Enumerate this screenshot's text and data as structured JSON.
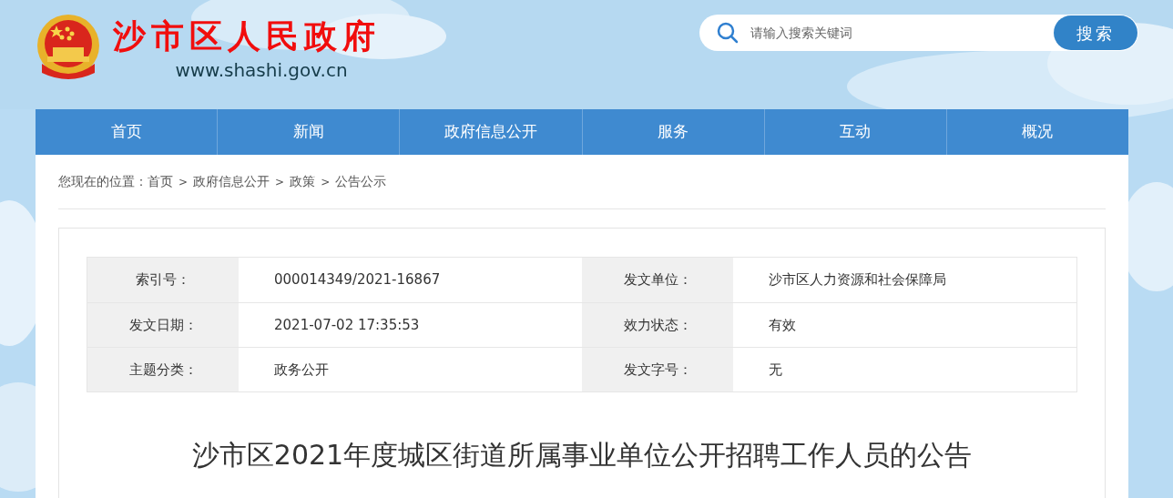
{
  "header": {
    "site_title": "沙市区人民政府",
    "site_url": "www.shashi.gov.cn"
  },
  "search": {
    "placeholder": "请输入搜索关键词",
    "button": "搜索"
  },
  "nav": [
    "首页",
    "新闻",
    "政府信息公开",
    "服务",
    "互动",
    "概况"
  ],
  "breadcrumb": [
    {
      "kind": "text",
      "text": "您现在的位置："
    },
    {
      "kind": "link",
      "text": "首页"
    },
    {
      "kind": "sep",
      "text": ">"
    },
    {
      "kind": "link",
      "text": "政府信息公开"
    },
    {
      "kind": "sep",
      "text": ">"
    },
    {
      "kind": "link",
      "text": "政策"
    },
    {
      "kind": "sep",
      "text": ">"
    },
    {
      "kind": "link",
      "text": "公告公示"
    }
  ],
  "meta_table": [
    [
      {
        "label": "索引号：",
        "value": "000014349/2021-16867"
      },
      {
        "label": "发文单位：",
        "value": "沙市区人力资源和社会保障局"
      }
    ],
    [
      {
        "label": "发文日期：",
        "value": "2021-07-02 17:35:53"
      },
      {
        "label": "效力状态：",
        "value": "有效"
      }
    ],
    [
      {
        "label": "主题分类：",
        "value": "政务公开"
      },
      {
        "label": "发文字号：",
        "value": "无"
      }
    ]
  ],
  "article_title": "沙市区2021年度城区街道所属事业单位公开招聘工作人员的公告"
}
